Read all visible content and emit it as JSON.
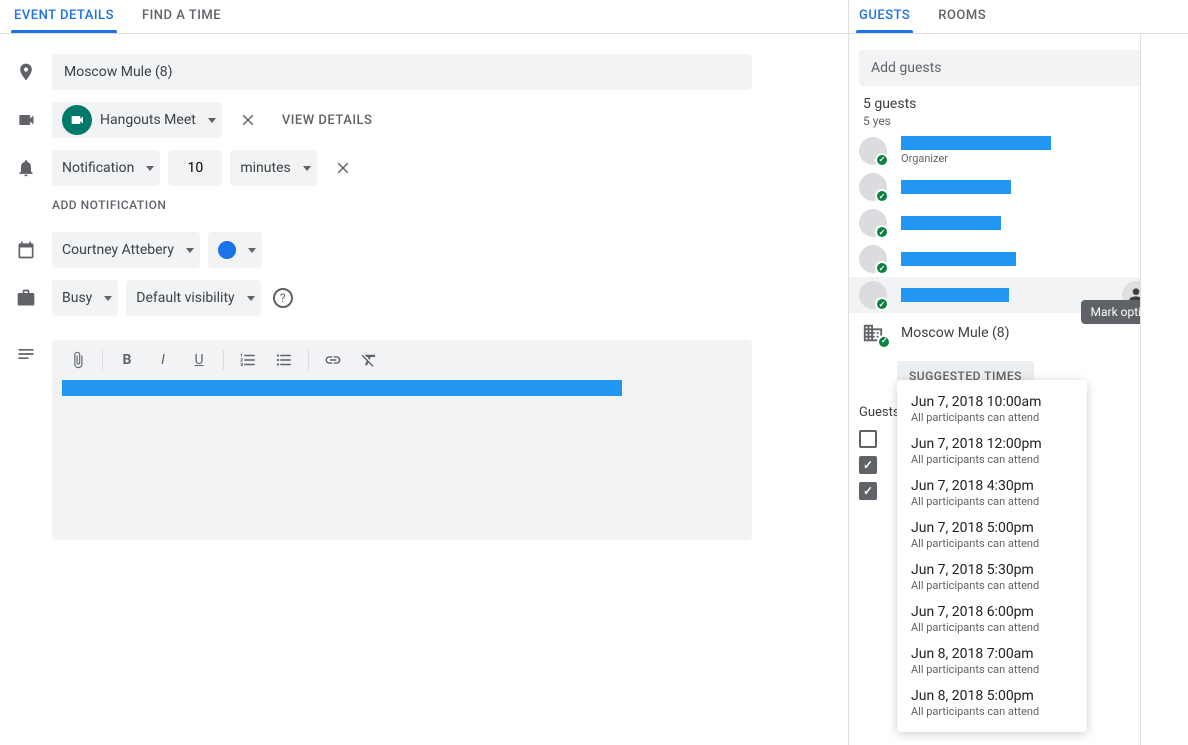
{
  "left_tabs": {
    "details": "EVENT DETAILS",
    "find_time": "FIND A TIME"
  },
  "right_tabs": {
    "guests": "GUESTS",
    "rooms": "ROOMS"
  },
  "location": "Moscow Mule (8)",
  "meet": {
    "label": "Hangouts Meet",
    "view_details": "VIEW DETAILS"
  },
  "notification": {
    "type": "Notification",
    "value": "10",
    "unit": "minutes",
    "add": "ADD NOTIFICATION"
  },
  "owner": "Courtney Attebery",
  "busy": "Busy",
  "visibility": "Default visibility",
  "guests": {
    "add_placeholder": "Add guests",
    "count": "5 guests",
    "yes": "5 yes",
    "organizer_label": "Organizer",
    "room": "Moscow Mule (8)",
    "tooltip": "Mark optional"
  },
  "suggested": {
    "button": "SUGGESTED TIMES",
    "sub": "All participants can attend",
    "times": [
      "Jun 7, 2018 10:00am",
      "Jun 7, 2018 12:00pm",
      "Jun 7, 2018 4:30pm",
      "Jun 7, 2018 5:00pm",
      "Jun 7, 2018 5:30pm",
      "Jun 7, 2018 6:00pm",
      "Jun 8, 2018 7:00am",
      "Jun 8, 2018 5:00pm"
    ]
  },
  "perms_title": "Guests"
}
